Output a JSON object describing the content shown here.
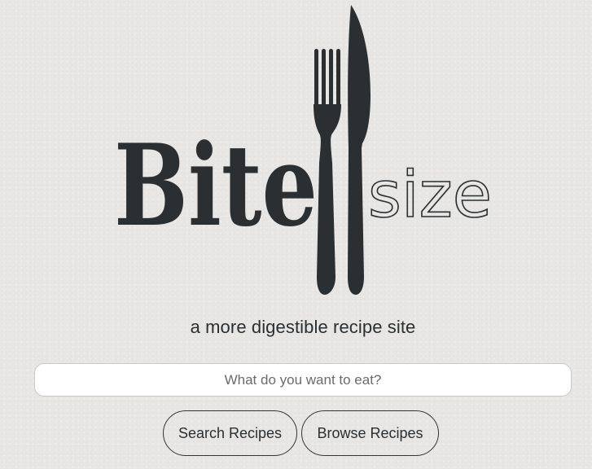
{
  "logo": {
    "word_bold": "Bite",
    "word_light": "size",
    "icon": "fork-and-knife-icon"
  },
  "tagline": "a more digestible recipe site",
  "search": {
    "placeholder": "What do you want to eat?",
    "value": ""
  },
  "buttons": {
    "search_label": "Search Recipes",
    "browse_label": "Browse Recipes"
  },
  "colors": {
    "background": "#e7e6e4",
    "ink": "#2b2f31",
    "input_bg": "#ffffff"
  }
}
